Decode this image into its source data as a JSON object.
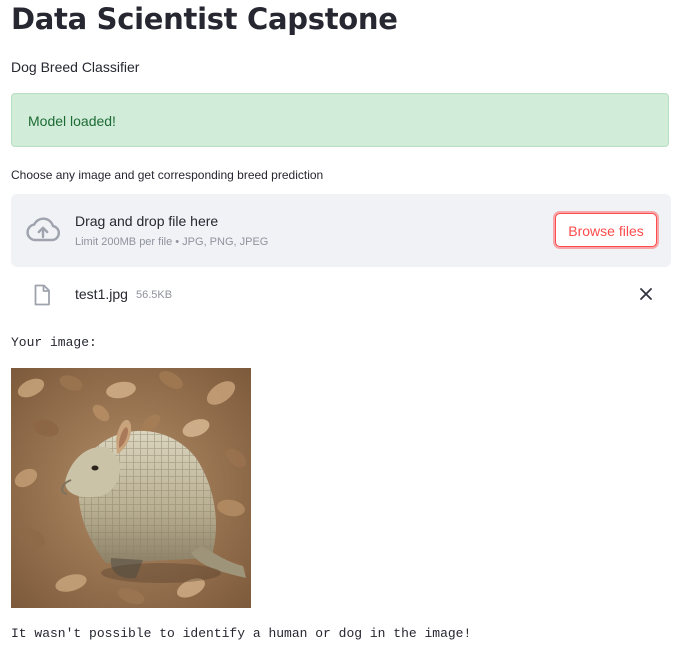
{
  "header": {
    "title": "Data Scientist Capstone",
    "subtitle": "Dog Breed Classifier"
  },
  "alert": {
    "message": "Model loaded!",
    "colors": {
      "background": "#d1ecd9",
      "text": "#1d6b34"
    }
  },
  "uploader": {
    "label": "Choose any image and get corresponding breed prediction",
    "drop_text": "Drag and drop file here",
    "limit_text": "Limit 200MB per file • JPG, PNG, JPEG",
    "browse_label": "Browse files",
    "icon": "cloud-upload-icon",
    "accent": "#ff4b4b"
  },
  "uploaded_file": {
    "name": "test1.jpg",
    "size": "56.5KB",
    "icon": "file-icon",
    "remove_icon": "close-icon"
  },
  "output": {
    "image_caption": "Your image:",
    "image_subject": "armadillo on dry leaves",
    "result": "It wasn't possible to identify a human or dog in the image!"
  }
}
